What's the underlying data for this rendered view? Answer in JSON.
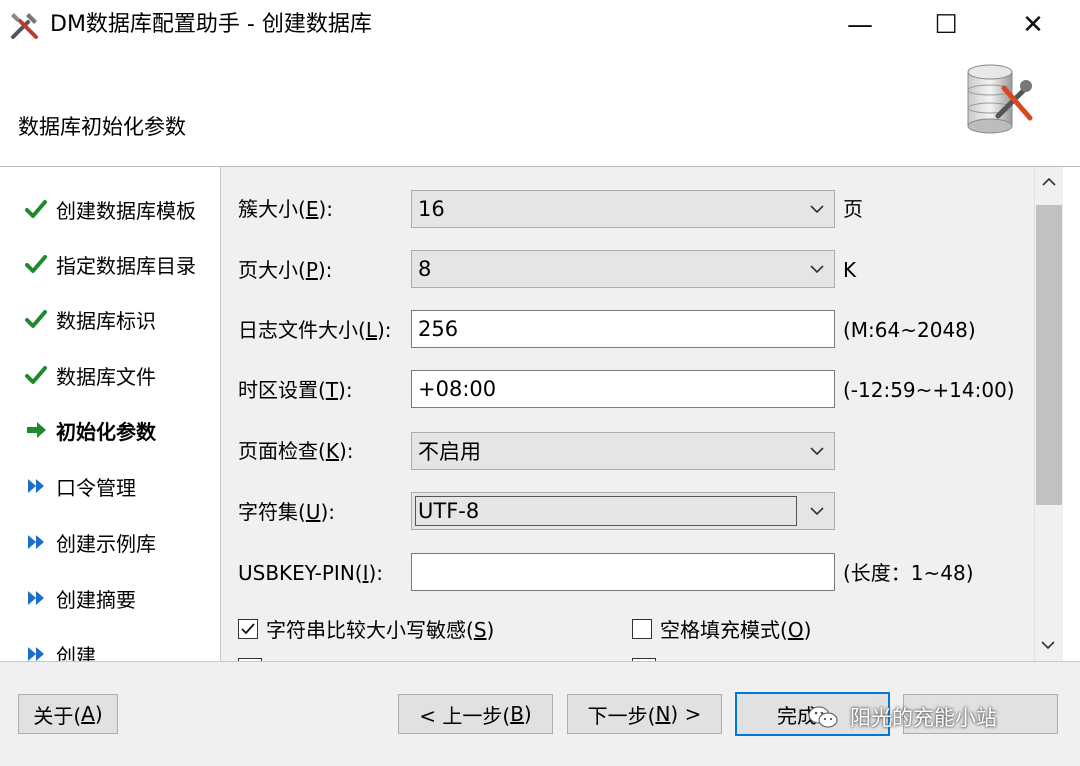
{
  "window": {
    "title": "DM数据库配置助手 - 创建数据库",
    "minimize_glyph": "—",
    "maximize_glyph": "☐",
    "close_glyph": "✕"
  },
  "header": {
    "title": "数据库初始化参数",
    "graphic_icon": "database-tools-icon"
  },
  "steps": [
    {
      "label": "创建数据库模板",
      "state": "done"
    },
    {
      "label": "指定数据库目录",
      "state": "done"
    },
    {
      "label": "数据库标识",
      "state": "done"
    },
    {
      "label": "数据库文件",
      "state": "done"
    },
    {
      "label": "初始化参数",
      "state": "current"
    },
    {
      "label": "口令管理",
      "state": "pending"
    },
    {
      "label": "创建示例库",
      "state": "pending"
    },
    {
      "label": "创建摘要",
      "state": "pending"
    },
    {
      "label": "创建",
      "state": "pending"
    }
  ],
  "form": {
    "extent_size": {
      "label_pre": "簇大小(",
      "key": "E",
      "label_post": "):",
      "value": "16",
      "unit": "页"
    },
    "page_size": {
      "label_pre": "页大小(",
      "key": "P",
      "label_post": "):",
      "value": "8",
      "unit": "K"
    },
    "log_size": {
      "label_pre": "日志文件大小(",
      "key": "L",
      "label_post": "):",
      "value": "256",
      "hint": "(M:64~2048)"
    },
    "time_zone": {
      "label_pre": "时区设置(",
      "key": "T",
      "label_post": "):",
      "value": "+08:00",
      "hint": "(-12:59~+14:00)"
    },
    "page_check": {
      "label_pre": "页面检查(",
      "key": "K",
      "label_post": "):",
      "value": "不启用"
    },
    "charset": {
      "label_pre": "字符集(",
      "key": "U",
      "label_post": "):",
      "value": "UTF-8"
    },
    "usbkey_pin": {
      "label_pre": "USBKEY-PIN(",
      "key": "I",
      "label_post": "):",
      "value": "",
      "hint": "(长度：1~48)"
    },
    "case_sensitive": {
      "label_pre": "字符串比较大小写敏感(",
      "key": "S",
      "label_post": ")",
      "checked": true
    },
    "blank_pad": {
      "label_pre": "空格填充模式(",
      "key": "O",
      "label_post": ")",
      "checked": false
    }
  },
  "buttons": {
    "about": {
      "label_pre": "关于(",
      "key": "A",
      "label_post": ")"
    },
    "prev": {
      "label_pre": "< 上一步(",
      "key": "B",
      "label_post": ")"
    },
    "next": {
      "label_pre": "下一步(",
      "key": "N",
      "label_post": ") >"
    },
    "finish": {
      "label": "完成"
    },
    "cancel": {
      "label": ""
    }
  },
  "watermark": {
    "text": "阳光的充能小站",
    "icon": "wechat-icon"
  },
  "colors": {
    "check": "#1e8a2e",
    "pending_arrow": "#1a6fc9",
    "current_arrow": "#1e8a2e",
    "focus_border": "#0078d7"
  }
}
